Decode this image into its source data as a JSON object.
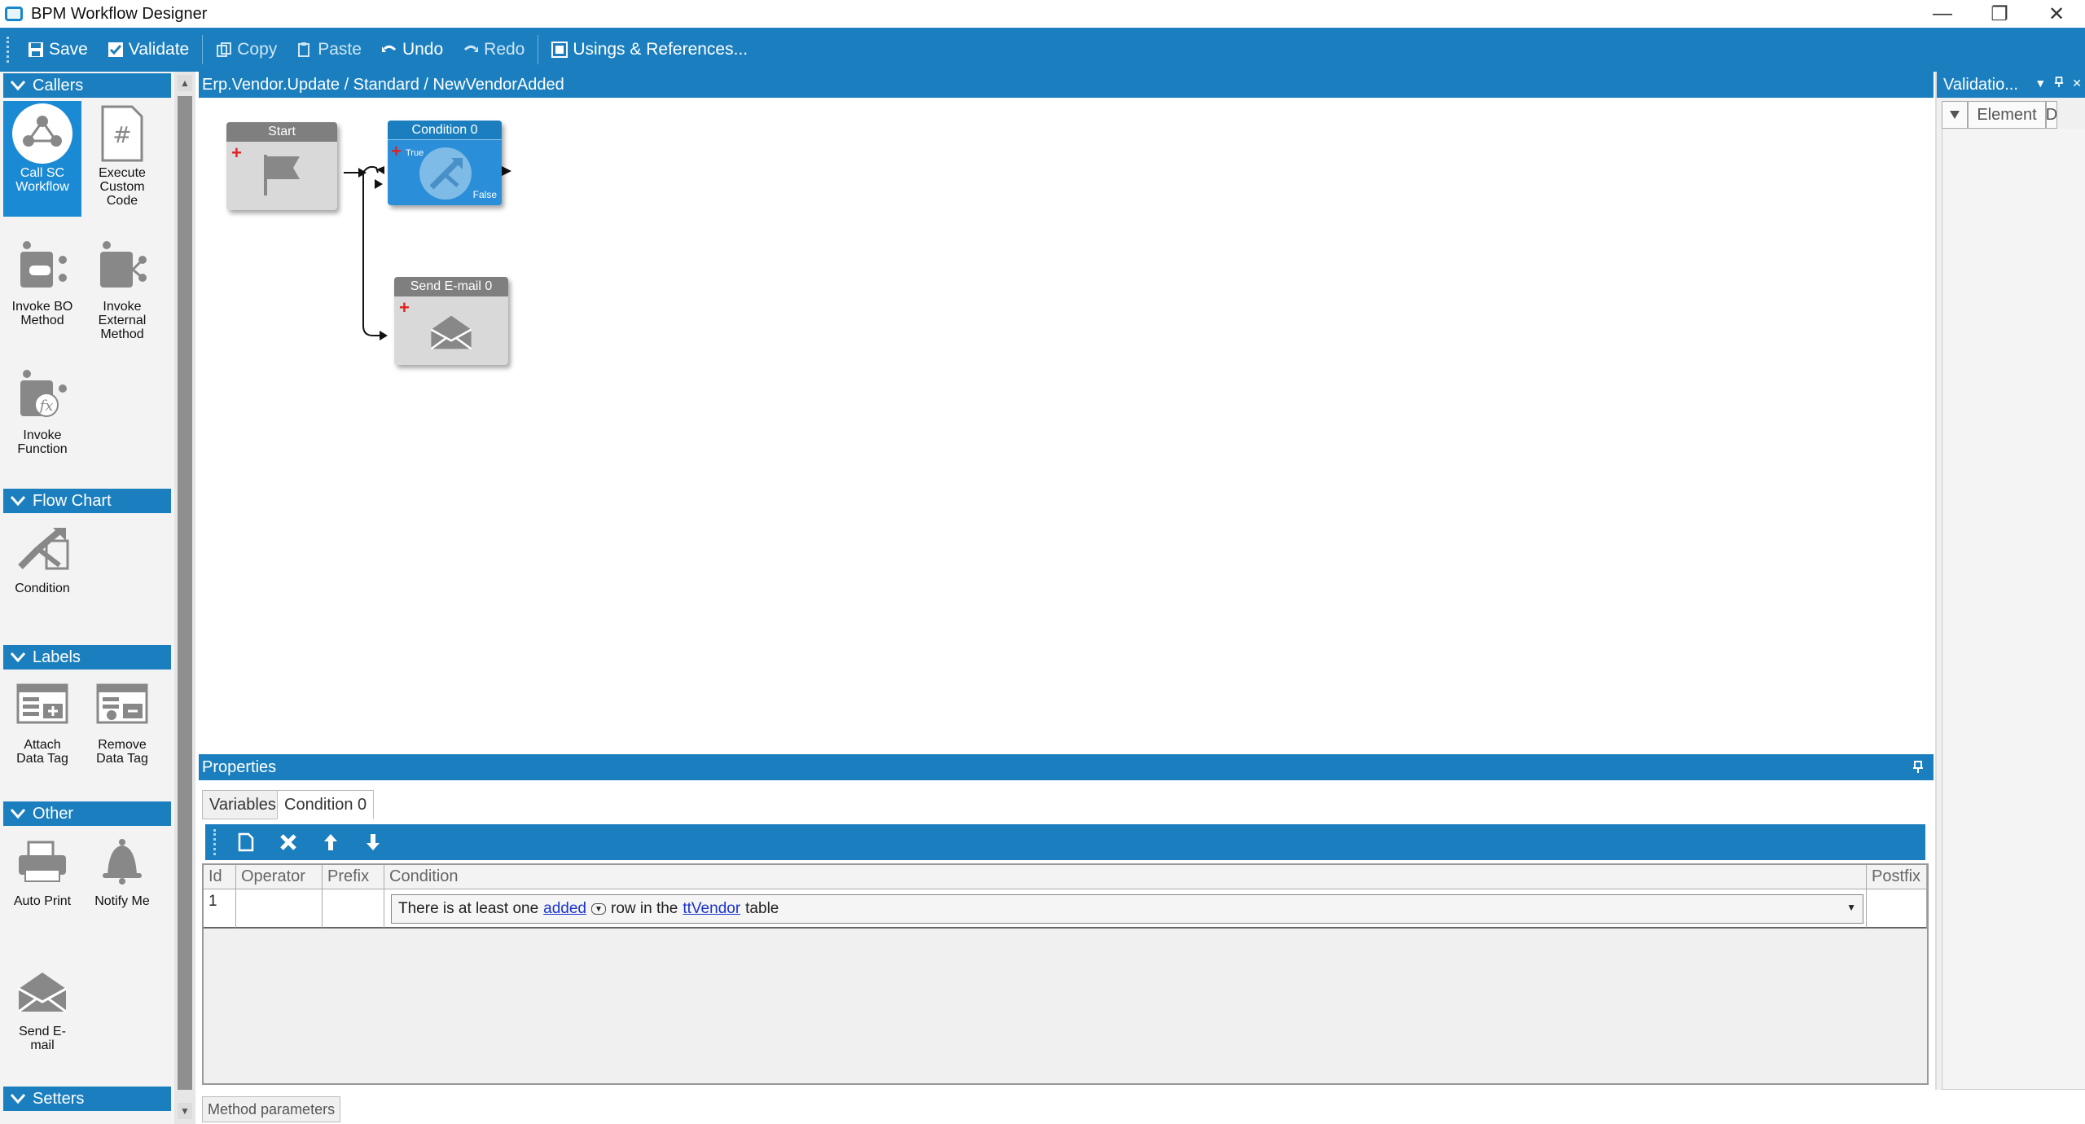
{
  "window": {
    "title": "BPM Workflow Designer",
    "controls": [
      "—",
      "❐",
      "✕"
    ]
  },
  "toolbar": {
    "save": "Save",
    "validate": "Validate",
    "copy": "Copy",
    "paste": "Paste",
    "undo": "Undo",
    "redo": "Redo",
    "usings": "Usings & References..."
  },
  "toolbox": {
    "groups": {
      "callers": "Callers",
      "flowchart": "Flow Chart",
      "labels": "Labels",
      "other": "Other",
      "setters": "Setters"
    },
    "tools": {
      "call_sc_workflow": [
        "Call SC",
        "Workflow"
      ],
      "execute_custom_code": [
        "Execute",
        "Custom",
        "Code"
      ],
      "invoke_bo_method": [
        "Invoke BO",
        "Method"
      ],
      "invoke_external_method": [
        "Invoke",
        "External",
        "Method"
      ],
      "invoke_function": [
        "Invoke",
        "Function"
      ],
      "condition": [
        "Condition"
      ],
      "attach_data_tag": [
        "Attach",
        "Data Tag"
      ],
      "remove_data_tag": [
        "Remove",
        "Data Tag"
      ],
      "auto_print": [
        "Auto Print"
      ],
      "notify_me": [
        "Notify Me"
      ],
      "send_email": [
        "Send E-",
        "mail"
      ]
    }
  },
  "designer": {
    "breadcrumb": "Erp.Vendor.Update / Standard / NewVendorAdded",
    "nodes": {
      "start": "Start",
      "condition": "Condition 0",
      "condition_true": "True",
      "condition_false": "False",
      "send_email": "Send E-mail 0"
    }
  },
  "properties": {
    "title": "Properties",
    "tabs": [
      "Variables",
      "Condition 0"
    ],
    "grid": {
      "columns": [
        "Id",
        "Operator",
        "Prefix",
        "Condition",
        "Postfix"
      ],
      "rows": [
        {
          "id": "1",
          "operator": "",
          "prefix": "",
          "condition_pre": "There is at least one",
          "condition_link1": "added",
          "condition_mid": "row in the",
          "condition_link2": "ttVendor",
          "condition_post": "table",
          "postfix": ""
        }
      ]
    }
  },
  "bottom_tab": "Method parameters",
  "validation": {
    "title": "Validatio...",
    "columns": [
      "",
      "Element",
      "D"
    ]
  },
  "colors": {
    "accent": "#1b7fbf",
    "selected": "#1b8ad4",
    "link": "#1a33cc",
    "plus": "#e02222"
  }
}
